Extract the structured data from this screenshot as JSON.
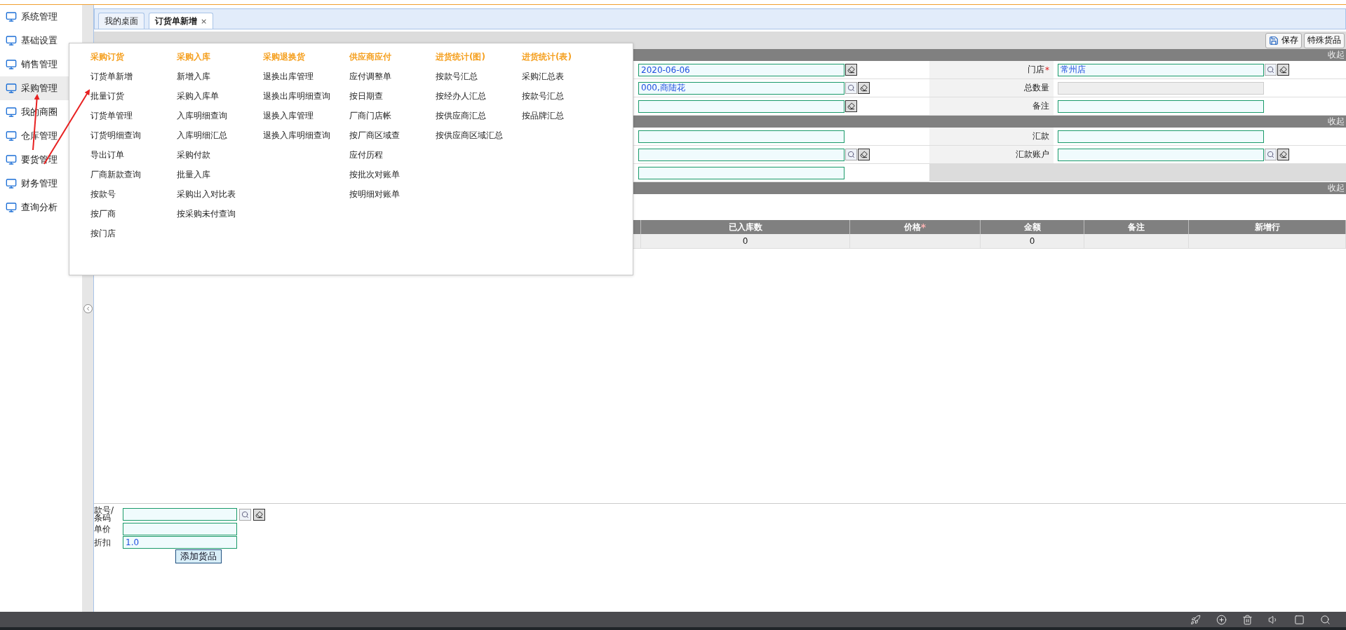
{
  "sidebar": {
    "items": [
      {
        "label": "系统管理",
        "selected": false
      },
      {
        "label": "基础设置",
        "selected": false
      },
      {
        "label": "销售管理",
        "selected": false
      },
      {
        "label": "采购管理",
        "selected": true
      },
      {
        "label": "我的商圈",
        "selected": false
      },
      {
        "label": "仓库管理",
        "selected": false
      },
      {
        "label": "要货管理",
        "selected": false
      },
      {
        "label": "财务管理",
        "selected": false
      },
      {
        "label": "查询分析",
        "selected": false
      }
    ]
  },
  "tabs": [
    {
      "label": "我的桌面",
      "selected": false
    },
    {
      "label": "订货单新增",
      "selected": true,
      "close": "×"
    }
  ],
  "toolbar": {
    "buttons": [
      {
        "label": "保存",
        "kind": "save"
      },
      {
        "label": "特殊货品",
        "kind": "plain"
      }
    ]
  },
  "sections": [
    {
      "toggle": "收起",
      "rows": [
        {
          "left": {
            "value": "2020-06-06",
            "actions": [
              {
                "kind": "eraser"
              }
            ]
          },
          "right": {
            "label": "门店",
            "required_mark": "*",
            "value": "常州店",
            "actions": [
              {
                "kind": "search"
              },
              {
                "kind": "eraser"
              }
            ]
          }
        },
        {
          "left": {
            "value": "000,商陆花",
            "actions": [
              {
                "kind": "search"
              },
              {
                "kind": "eraser"
              }
            ]
          },
          "right": {
            "label": "总数量",
            "disabled": true
          }
        },
        {
          "left": {
            "actions": [
              {
                "kind": "eraser"
              }
            ]
          },
          "right": {
            "label": "备注"
          }
        }
      ]
    },
    {
      "toggle": "收起",
      "rows": [
        {
          "left": {},
          "right": {
            "label": "汇款"
          }
        },
        {
          "left": {
            "actions": [
              {
                "kind": "search"
              },
              {
                "kind": "eraser"
              }
            ]
          },
          "right": {
            "label": "汇款账户",
            "actions": [
              {
                "kind": "search"
              },
              {
                "kind": "eraser"
              }
            ]
          }
        },
        {
          "left": {}
        }
      ]
    },
    {
      "toggle": "收起"
    }
  ],
  "table": {
    "columns": [
      {
        "label": "已入库数"
      },
      {
        "label": "价格",
        "required_mark": "*"
      },
      {
        "label": "金额"
      },
      {
        "label": "备注"
      },
      {
        "label": "新增行"
      }
    ],
    "rows": [
      [
        "0",
        null,
        "0",
        null,
        null
      ]
    ]
  },
  "entry": {
    "fields": [
      {
        "label": "款号/条码",
        "actions": [
          {
            "kind": "search"
          },
          {
            "kind": "eraser"
          }
        ]
      },
      {
        "label": "单价"
      },
      {
        "label": "折扣",
        "value": "1.0"
      }
    ],
    "button": "添加货品"
  },
  "menu": {
    "columns": [
      {
        "title": "采购订货",
        "items": [
          "订货单新增",
          "批量订货",
          "订货单管理",
          "订货明细查询",
          "导出订单",
          "厂商新款查询",
          "按款号",
          "按厂商",
          "按门店"
        ]
      },
      {
        "title": "采购入库",
        "items": [
          "新增入库",
          "采购入库单",
          "入库明细查询",
          "入库明细汇总",
          "采购付款",
          "批量入库",
          "采购出入对比表",
          "按采购未付查询"
        ]
      },
      {
        "title": "采购退换货",
        "items": [
          "退换出库管理",
          "退换出库明细查询",
          "退换入库管理",
          "退换入库明细查询"
        ]
      },
      {
        "title": "供应商应付",
        "items": [
          "应付调整单",
          "按日期查",
          "厂商门店帐",
          "按厂商区域查",
          "应付历程",
          "按批次对账单",
          "按明细对账单"
        ]
      },
      {
        "title": "进货统计(图)",
        "items": [
          "按款号汇总",
          "按经办人汇总",
          "按供应商汇总",
          "按供应商区域汇总"
        ]
      },
      {
        "title": "进货统计(表)",
        "items": [
          "采购汇总表",
          "按款号汇总",
          "按品牌汇总"
        ]
      }
    ]
  },
  "taskbar": {
    "icons": [
      {
        "kind": "rocket"
      },
      {
        "kind": "circle-plus"
      },
      {
        "kind": "trash"
      },
      {
        "kind": "speaker"
      },
      {
        "kind": "window"
      },
      {
        "kind": "search"
      }
    ]
  }
}
